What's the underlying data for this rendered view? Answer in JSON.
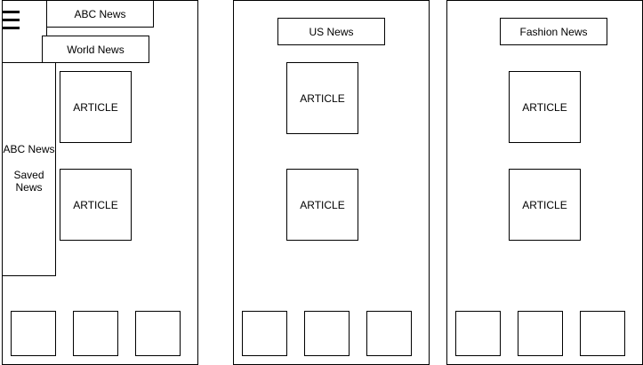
{
  "screens": [
    {
      "title": "ABC News",
      "subtitle": "World News",
      "drawer": {
        "item_1": "ABC News",
        "item_2": "Saved News"
      },
      "articles": [
        "ARTICLE",
        "ARTICLE"
      ],
      "menu_icon": "hamburger-icon"
    },
    {
      "title": "US News",
      "articles": [
        "ARTICLE",
        "ARTICLE"
      ]
    },
    {
      "title": "Fashion News",
      "articles": [
        "ARTICLE",
        "ARTICLE"
      ]
    }
  ],
  "colors": {
    "stroke": "#000000",
    "fill": "#ffffff"
  }
}
